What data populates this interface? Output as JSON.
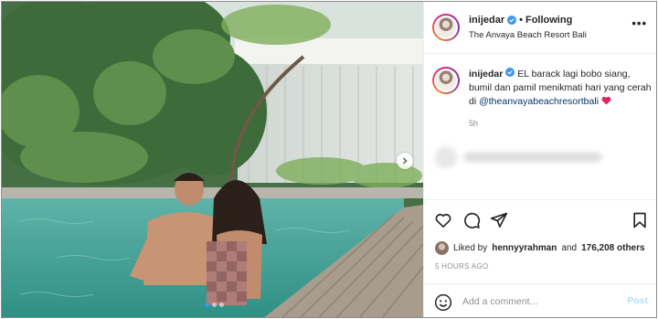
{
  "post": {
    "username": "inijedar",
    "follow_label": "Following",
    "separator": "•",
    "location": "The Anvaya Beach Resort Bali",
    "more_label": "•••"
  },
  "caption": {
    "username": "inijedar",
    "text": "EL barack lagi bobo siang, bumil dan pamil menikmati hari yang cerah di",
    "mention": "@theanvayabeachresortbali",
    "time_ago": "5h"
  },
  "likes": {
    "prefix": "Liked by",
    "user": "hennyyrahman",
    "conjunction": "and",
    "count": "176,208 others"
  },
  "timestamp": "5 HOURS AGO",
  "comment": {
    "placeholder": "Add a comment...",
    "post_label": "Post"
  },
  "carousel": {
    "total": 3,
    "active_index": 0
  },
  "colors": {
    "link_blue": "#00376b",
    "verified_blue": "#3897f0",
    "post_disabled": "#b2dffc",
    "heart_red": "#e0245e"
  },
  "icons": [
    "verified-icon",
    "heart-icon",
    "comment-icon",
    "share-icon",
    "bookmark-icon",
    "emoji-icon",
    "chevron-right-icon"
  ]
}
